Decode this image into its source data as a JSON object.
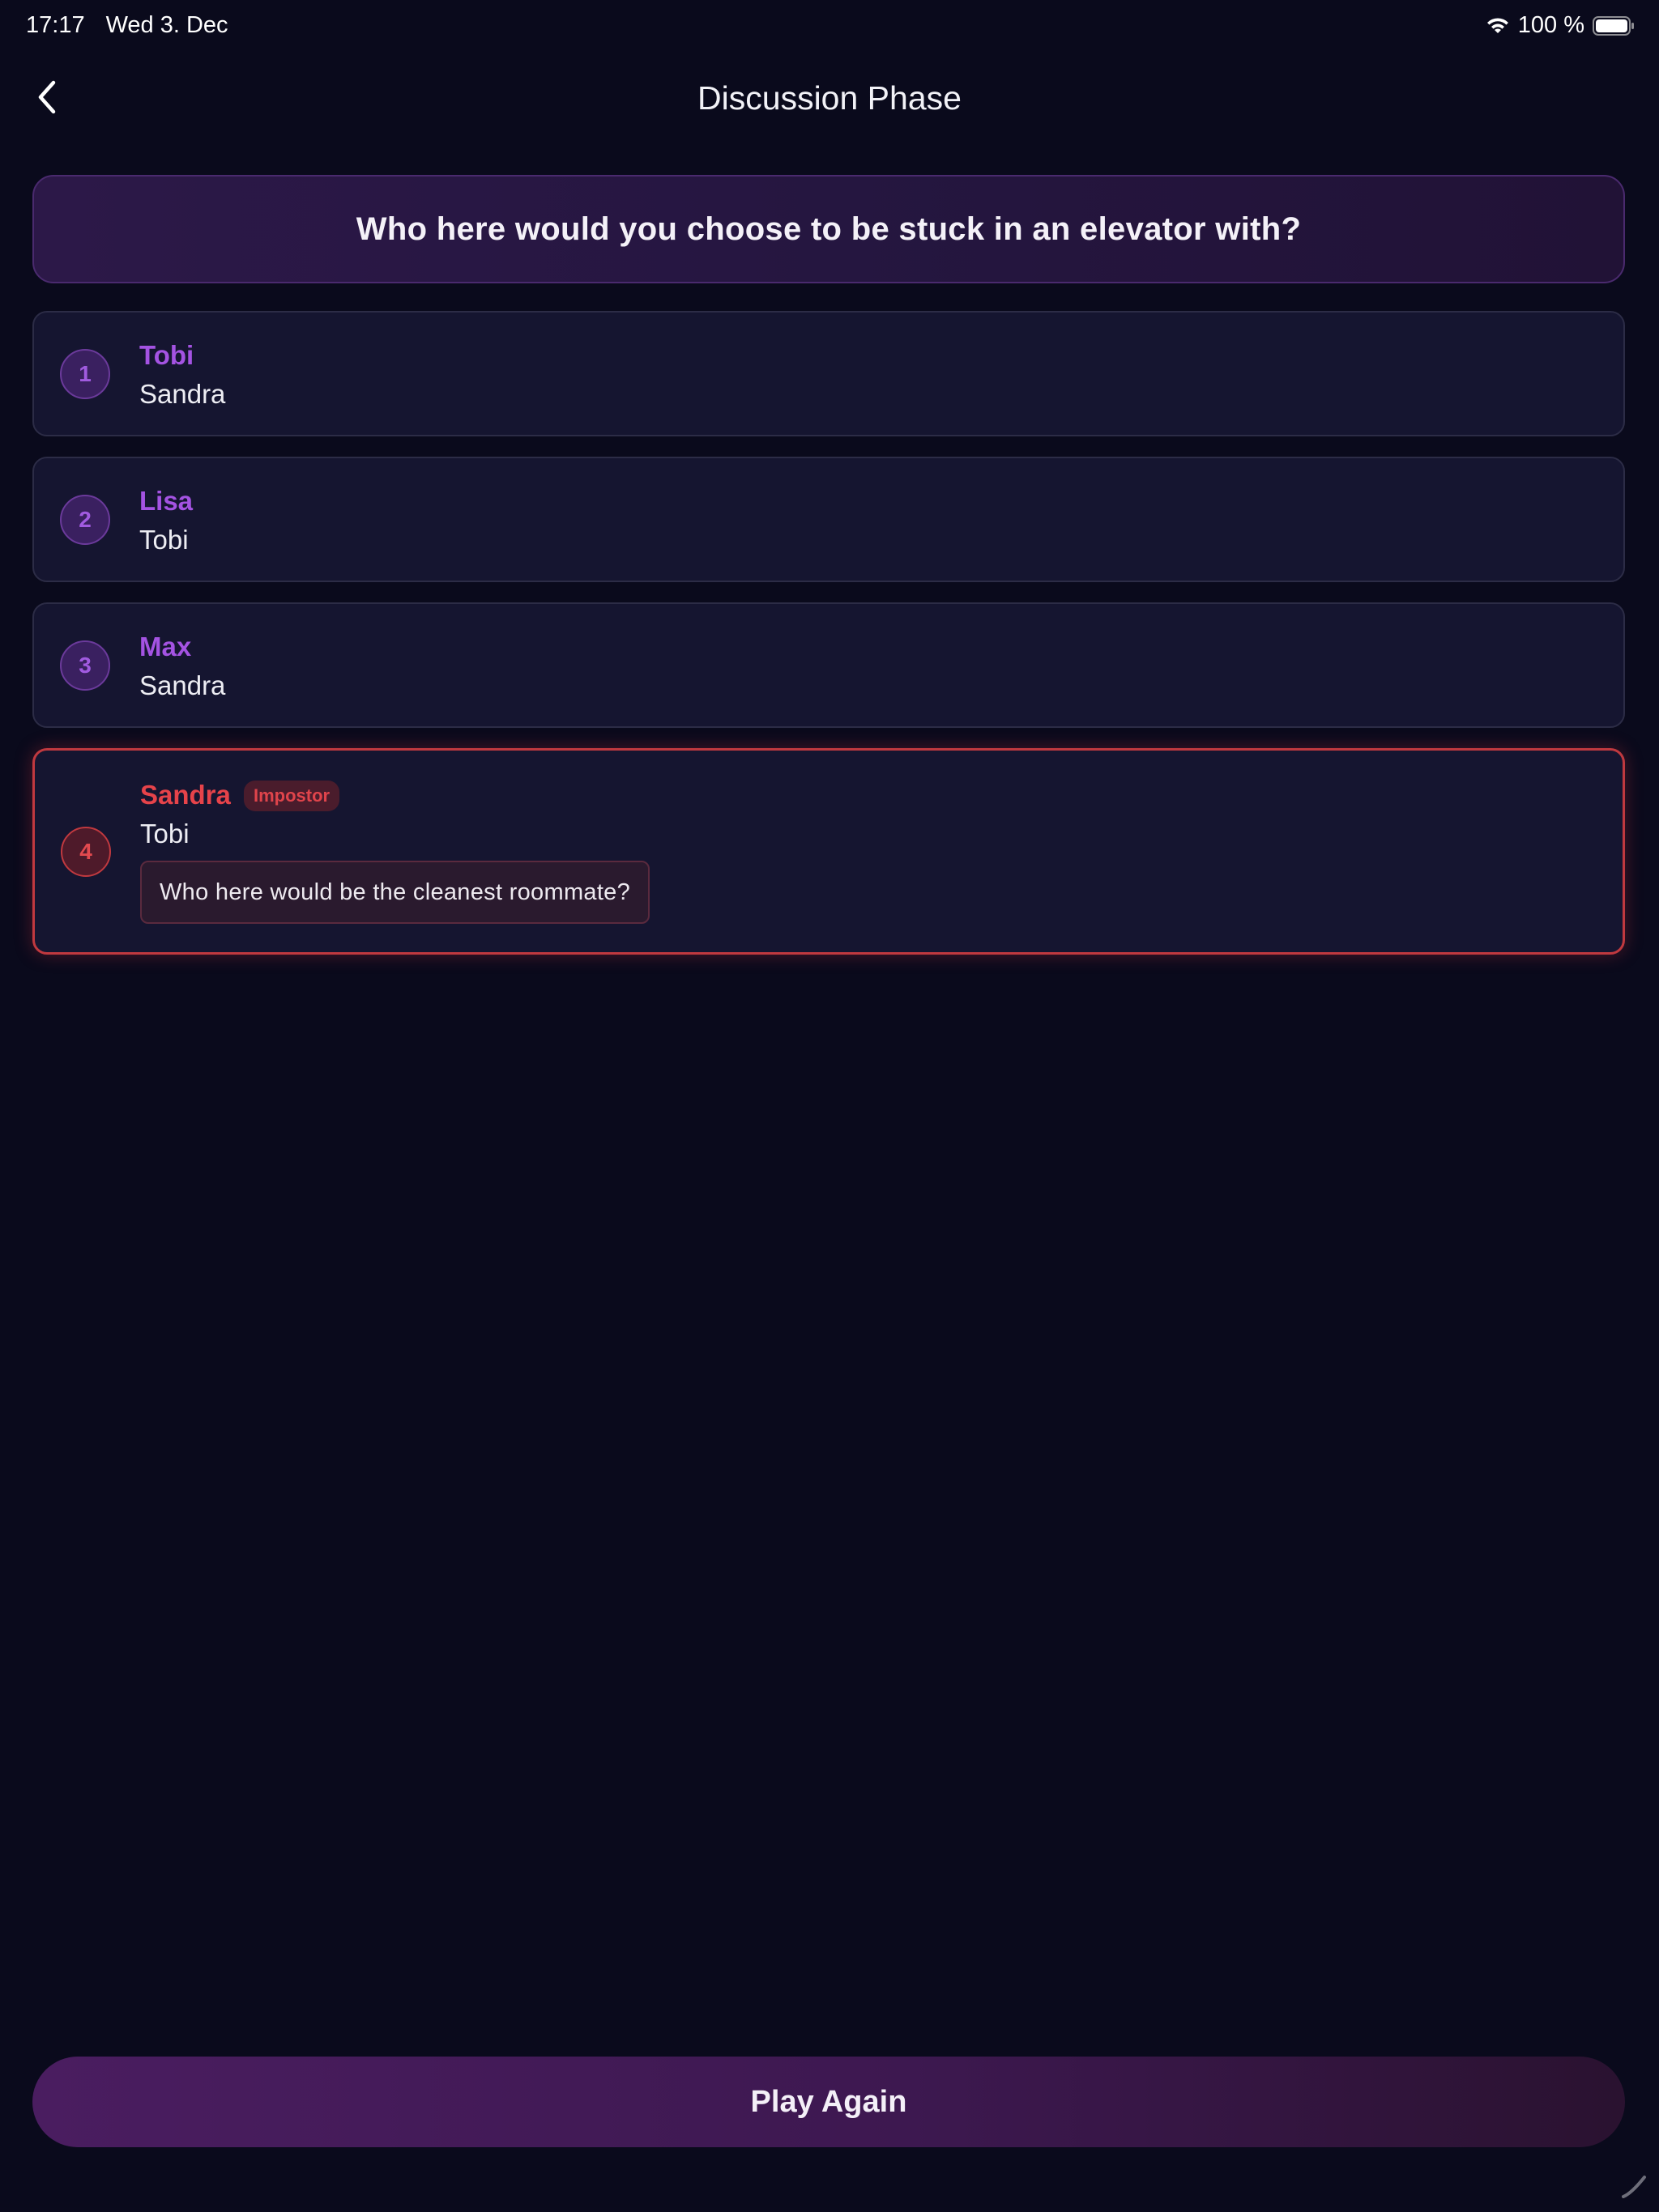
{
  "status_bar": {
    "time": "17:17",
    "date": "Wed 3. Dec",
    "battery_percent": "100 %",
    "battery_level": 1.0
  },
  "nav": {
    "back_icon": "chevron-left-icon",
    "title": "Discussion Phase"
  },
  "question": {
    "text": "Who here would you choose to be stuck in an elevator with?"
  },
  "players": [
    {
      "number": "1",
      "name": "Tobi",
      "answer": "Sandra",
      "impostor": false
    },
    {
      "number": "2",
      "name": "Lisa",
      "answer": "Tobi",
      "impostor": false
    },
    {
      "number": "3",
      "name": "Max",
      "answer": "Sandra",
      "impostor": false
    },
    {
      "number": "4",
      "name": "Sandra",
      "answer": "Tobi",
      "impostor": true,
      "impostor_label": "Impostor",
      "secret_question": "Who here would be the cleanest roommate?"
    }
  ],
  "actions": {
    "play_again_label": "Play Again"
  },
  "colors": {
    "background": "#0a0a1c",
    "accent_purple": "#a453e2",
    "impostor_red": "#e6434a"
  }
}
